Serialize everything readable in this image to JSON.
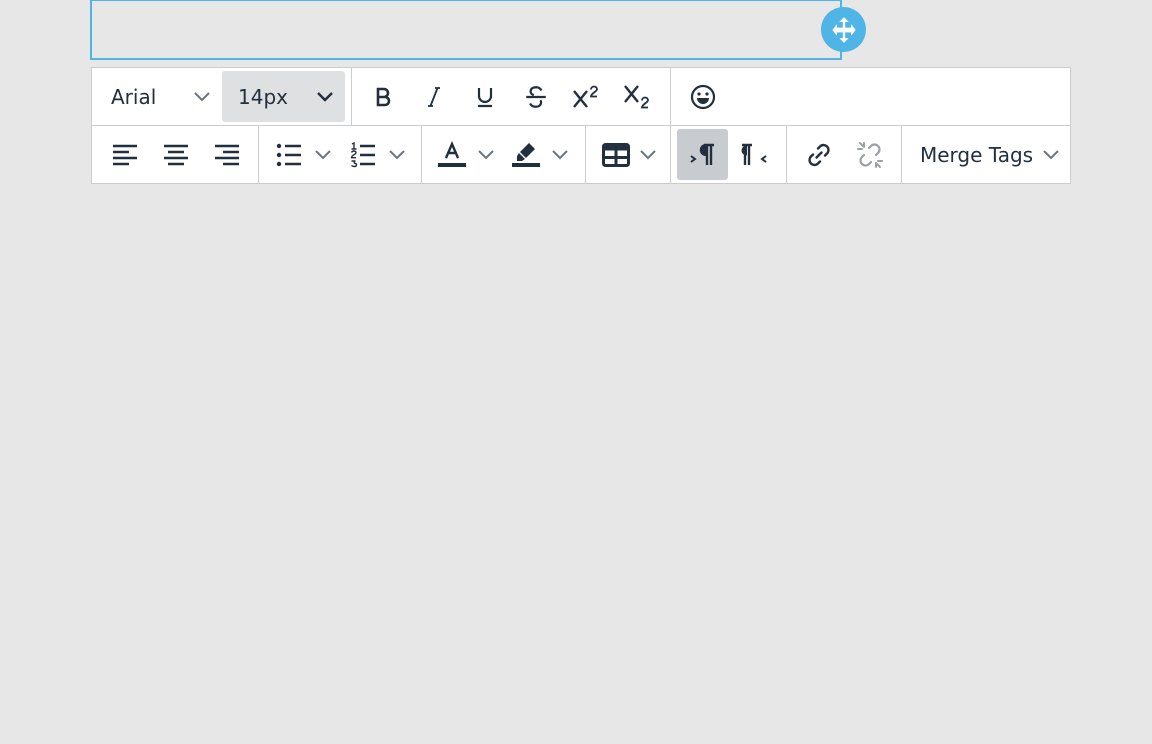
{
  "editor": {
    "font_family": {
      "value": "Arial"
    },
    "font_size": {
      "value": "14px"
    },
    "merge_tags": {
      "label": "Merge Tags"
    }
  },
  "icons": {
    "move": "move-icon",
    "bold": "bold-icon",
    "italic": "italic-icon",
    "underline": "underline-icon",
    "strikethrough": "strikethrough-icon",
    "superscript": "superscript-icon",
    "subscript": "subscript-icon",
    "emoticons": "emoji-icon",
    "align_left": "align-left-icon",
    "align_center": "align-center-icon",
    "align_right": "align-right-icon",
    "bullet_list": "bullet-list-icon",
    "numbered_list": "numbered-list-icon",
    "text_color": "text-color-icon",
    "highlight": "highlight-icon",
    "table": "table-icon",
    "ltr": "ltr-icon",
    "rtl": "rtl-icon",
    "link": "link-icon",
    "unlink": "unlink-icon"
  },
  "colors": {
    "accent": "#4eb5e6",
    "toolbar_bg": "#ffffff",
    "canvas_bg": "#e7e7e7",
    "icon": "#222f3e",
    "active_button": "#c8cbcf",
    "select_bg": "#dee0e2"
  }
}
